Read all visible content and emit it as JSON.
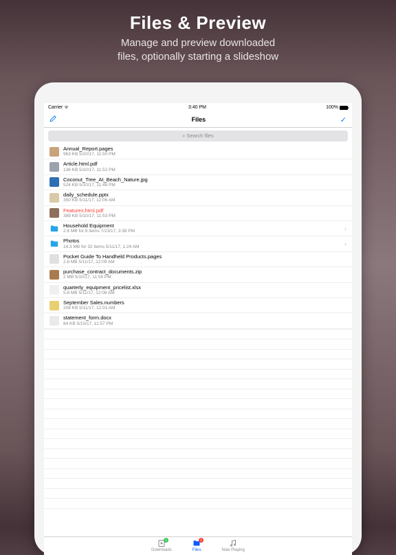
{
  "promo": {
    "title": "Files & Preview",
    "subtitle_l1": "Manage and preview downloaded",
    "subtitle_l2": "files, optionally starting a slideshow"
  },
  "statusbar": {
    "carrier": "Carrier",
    "wifi": "✶",
    "time": "3:40 PM",
    "battery_pct": "100%"
  },
  "navbar": {
    "title": "Files"
  },
  "search": {
    "placeholder": "Search files"
  },
  "files": [
    {
      "name": "Annual_Report.pages",
      "detail": "963 KB  5/10/17, 11:50 PM",
      "thumb": "#c9a37a",
      "folder": false,
      "selected": false
    },
    {
      "name": "Article.html.pdf",
      "detail": "136 KB  5/10/17, 11:52 PM",
      "thumb": "#9aa2ad",
      "folder": false,
      "selected": false
    },
    {
      "name": "Coconut_Tree_At_Beach_Nature.jpg",
      "detail": "524 KB  5/10/17, 11:48 PM",
      "thumb": "#2f6fb3",
      "folder": false,
      "selected": false
    },
    {
      "name": "daily_schedule.pptx",
      "detail": "350 KB  5/11/17, 12:06 AM",
      "thumb": "#d9c9a8",
      "folder": false,
      "selected": false
    },
    {
      "name": "Features.html.pdf",
      "detail": "389 KB  5/10/17, 11:53 PM",
      "thumb": "#8e6f5a",
      "folder": false,
      "selected": true
    },
    {
      "name": "Household Equipment",
      "detail": "2.6 MB for 8 items  7/23/17, 3:38 PM",
      "thumb": "#29a3e8",
      "folder": true,
      "selected": false
    },
    {
      "name": "Photos",
      "detail": "14.3 MB for 32 items  5/11/17, 1:24 AM",
      "thumb": "#29a3e8",
      "folder": true,
      "selected": false
    },
    {
      "name": "Pocket Guide To Handheld Products.pages",
      "detail": "2.8 MB  5/11/17, 12:09 AM",
      "thumb": "#e0e0e0",
      "folder": false,
      "selected": false
    },
    {
      "name": "purchase_contract_documents.zip",
      "detail": "2 MB  5/10/17, 11:55 PM",
      "thumb": "#a87c4f",
      "folder": false,
      "selected": false
    },
    {
      "name": "quarterly_equipment_pricelist.xlsx",
      "detail": "5.8 MB  5/11/17, 12:08 AM",
      "thumb": "#f0f0f0",
      "folder": false,
      "selected": false
    },
    {
      "name": "September Sales.numbers",
      "detail": "208 KB  5/11/17, 12:01 AM",
      "thumb": "#e8d070",
      "folder": false,
      "selected": false
    },
    {
      "name": "statement_form.docx",
      "detail": "84 KB  5/10/17, 11:57 PM",
      "thumb": "#eaeaea",
      "folder": false,
      "selected": false
    }
  ],
  "tabs": {
    "downloads": {
      "label": "Downloads",
      "badge": "1",
      "badge_color": "#34c759"
    },
    "files": {
      "label": "Files",
      "badge": "1",
      "badge_color": "#ff3b30"
    },
    "nowplaying": {
      "label": "Now Playing"
    }
  }
}
